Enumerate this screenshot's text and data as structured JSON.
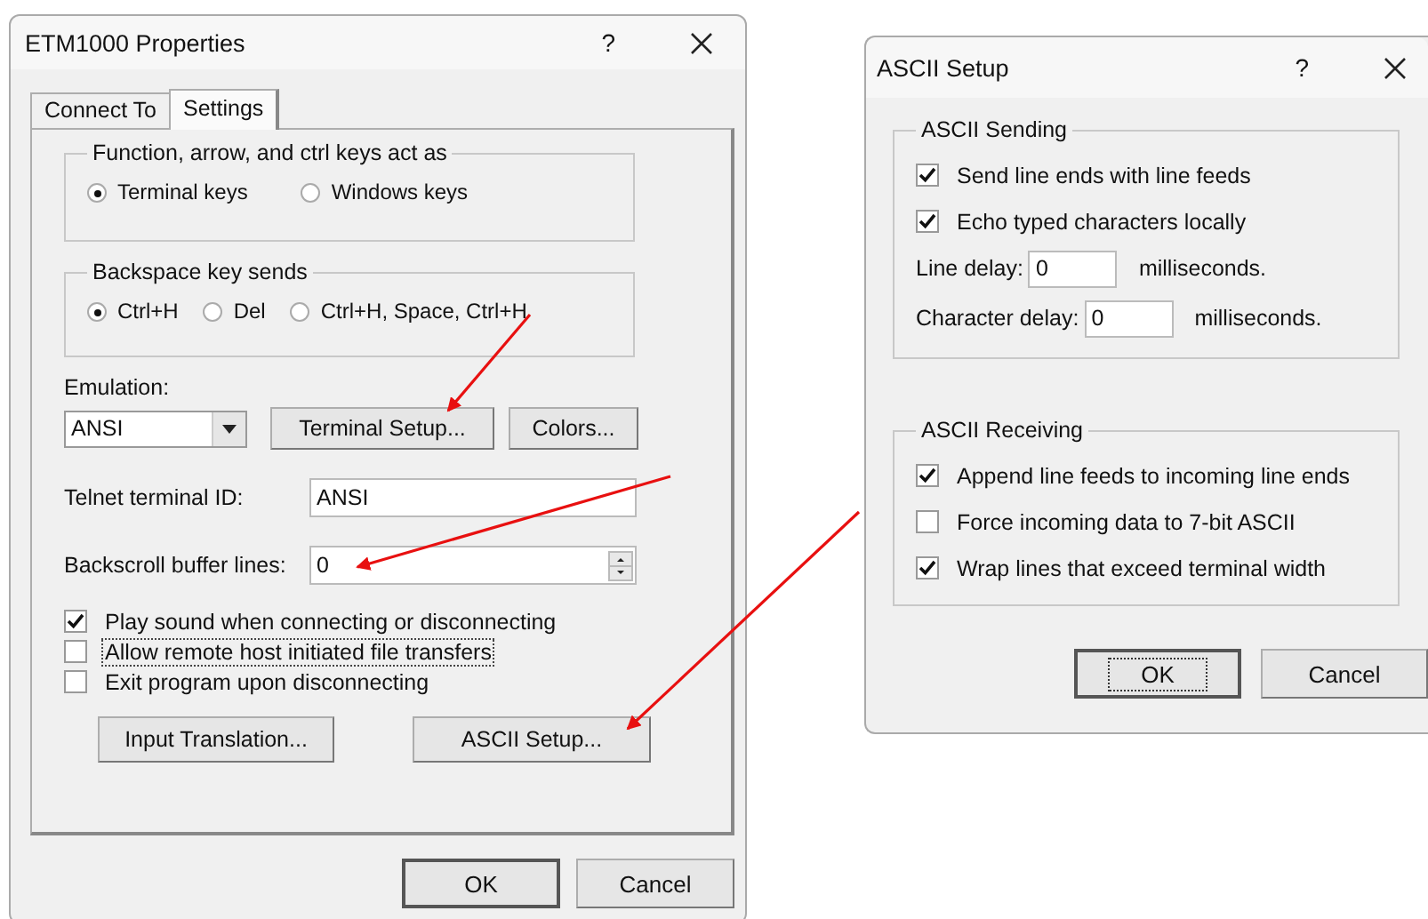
{
  "properties_dialog": {
    "title": "ETM1000 Properties",
    "help": "?",
    "tabs": [
      {
        "label": "Connect To",
        "selected": false
      },
      {
        "label": "Settings",
        "selected": true
      }
    ],
    "key_group": {
      "title": "Function, arrow, and ctrl keys act as",
      "options": [
        {
          "label": "Terminal keys",
          "selected": true
        },
        {
          "label": "Windows keys",
          "selected": false
        }
      ]
    },
    "backspace_group": {
      "title": "Backspace key sends",
      "options": [
        {
          "label": "Ctrl+H",
          "selected": true
        },
        {
          "label": "Del",
          "selected": false
        },
        {
          "label": "Ctrl+H, Space, Ctrl+H",
          "selected": false
        }
      ]
    },
    "emulation": {
      "label": "Emulation:",
      "value": "ANSI"
    },
    "setup_buttons": [
      "Terminal Setup...",
      "Colors..."
    ],
    "telnet_id": {
      "label": "Telnet terminal ID:",
      "value": "ANSI"
    },
    "backscroll": {
      "label": "Backscroll buffer lines:",
      "value": "0"
    },
    "checkboxes": [
      {
        "label": "Play sound when connecting or disconnecting",
        "checked": true,
        "focused": false
      },
      {
        "label": "Allow remote host initiated file transfers",
        "checked": false,
        "focused": true
      },
      {
        "label": "Exit program upon disconnecting",
        "checked": false,
        "focused": false
      }
    ],
    "action_buttons": [
      "Input Translation...",
      "ASCII Setup..."
    ],
    "footer_buttons": [
      {
        "label": "OK",
        "default": true,
        "focused": false
      },
      {
        "label": "Cancel",
        "default": false,
        "focused": false
      }
    ]
  },
  "ascii_dialog": {
    "title": "ASCII Setup",
    "help": "?",
    "sending": {
      "title": "ASCII Sending",
      "checkboxes": [
        {
          "label": "Send line ends with line feeds",
          "checked": true
        },
        {
          "label": "Echo typed characters locally",
          "checked": true
        }
      ],
      "delays": [
        {
          "label": "Line delay:",
          "value": "0",
          "unit": "milliseconds."
        },
        {
          "label": "Character delay:",
          "value": "0",
          "unit": "milliseconds."
        }
      ]
    },
    "receiving": {
      "title": "ASCII Receiving",
      "checkboxes": [
        {
          "label": "Append line feeds to incoming line ends",
          "checked": true
        },
        {
          "label": "Force incoming data to 7-bit ASCII",
          "checked": false
        },
        {
          "label": "Wrap lines that exceed terminal width",
          "checked": true
        }
      ]
    },
    "footer_buttons": [
      {
        "label": "OK",
        "default": true,
        "focused": true
      },
      {
        "label": "Cancel",
        "default": false,
        "focused": false
      }
    ]
  }
}
